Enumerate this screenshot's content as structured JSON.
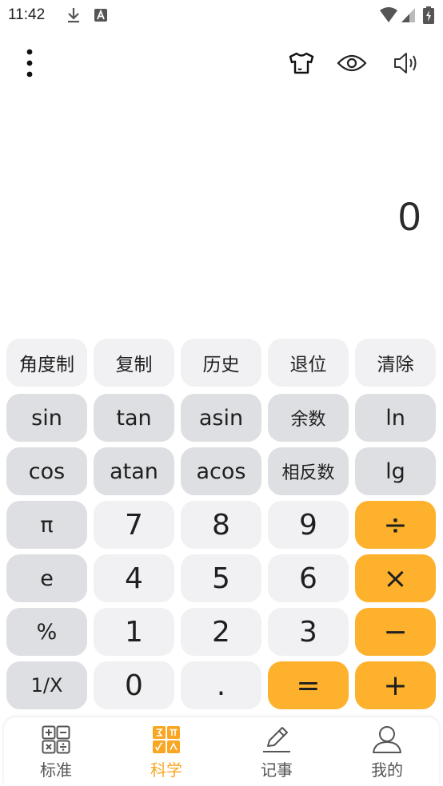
{
  "status_bar": {
    "time": "11:42"
  },
  "display": {
    "value": "0"
  },
  "keys": {
    "func": [
      "角度制",
      "复制",
      "历史",
      "退位",
      "清除"
    ],
    "row1": [
      "sin",
      "tan",
      "asin",
      "余数",
      "ln"
    ],
    "row2": [
      "cos",
      "atan",
      "acos",
      "相反数",
      "lg"
    ],
    "row3": [
      "π",
      "7",
      "8",
      "9",
      "÷"
    ],
    "row4": [
      "e",
      "4",
      "5",
      "6",
      "×"
    ],
    "row5": [
      "%",
      "1",
      "2",
      "3",
      "−"
    ],
    "row6": [
      "1/X",
      "0",
      ".",
      "=",
      "+"
    ]
  },
  "tabs": [
    {
      "label": "标准",
      "icon": "standard-calculator-icon"
    },
    {
      "label": "科学",
      "icon": "scientific-calculator-icon",
      "active": true
    },
    {
      "label": "记事",
      "icon": "notes-pencil-icon"
    },
    {
      "label": "我的",
      "icon": "profile-person-icon"
    }
  ],
  "colors": {
    "accent": "#fdb12c",
    "tab_active": "#f9a623",
    "key_light": "#f1f1f3",
    "key_gray": "#dedfe2"
  }
}
